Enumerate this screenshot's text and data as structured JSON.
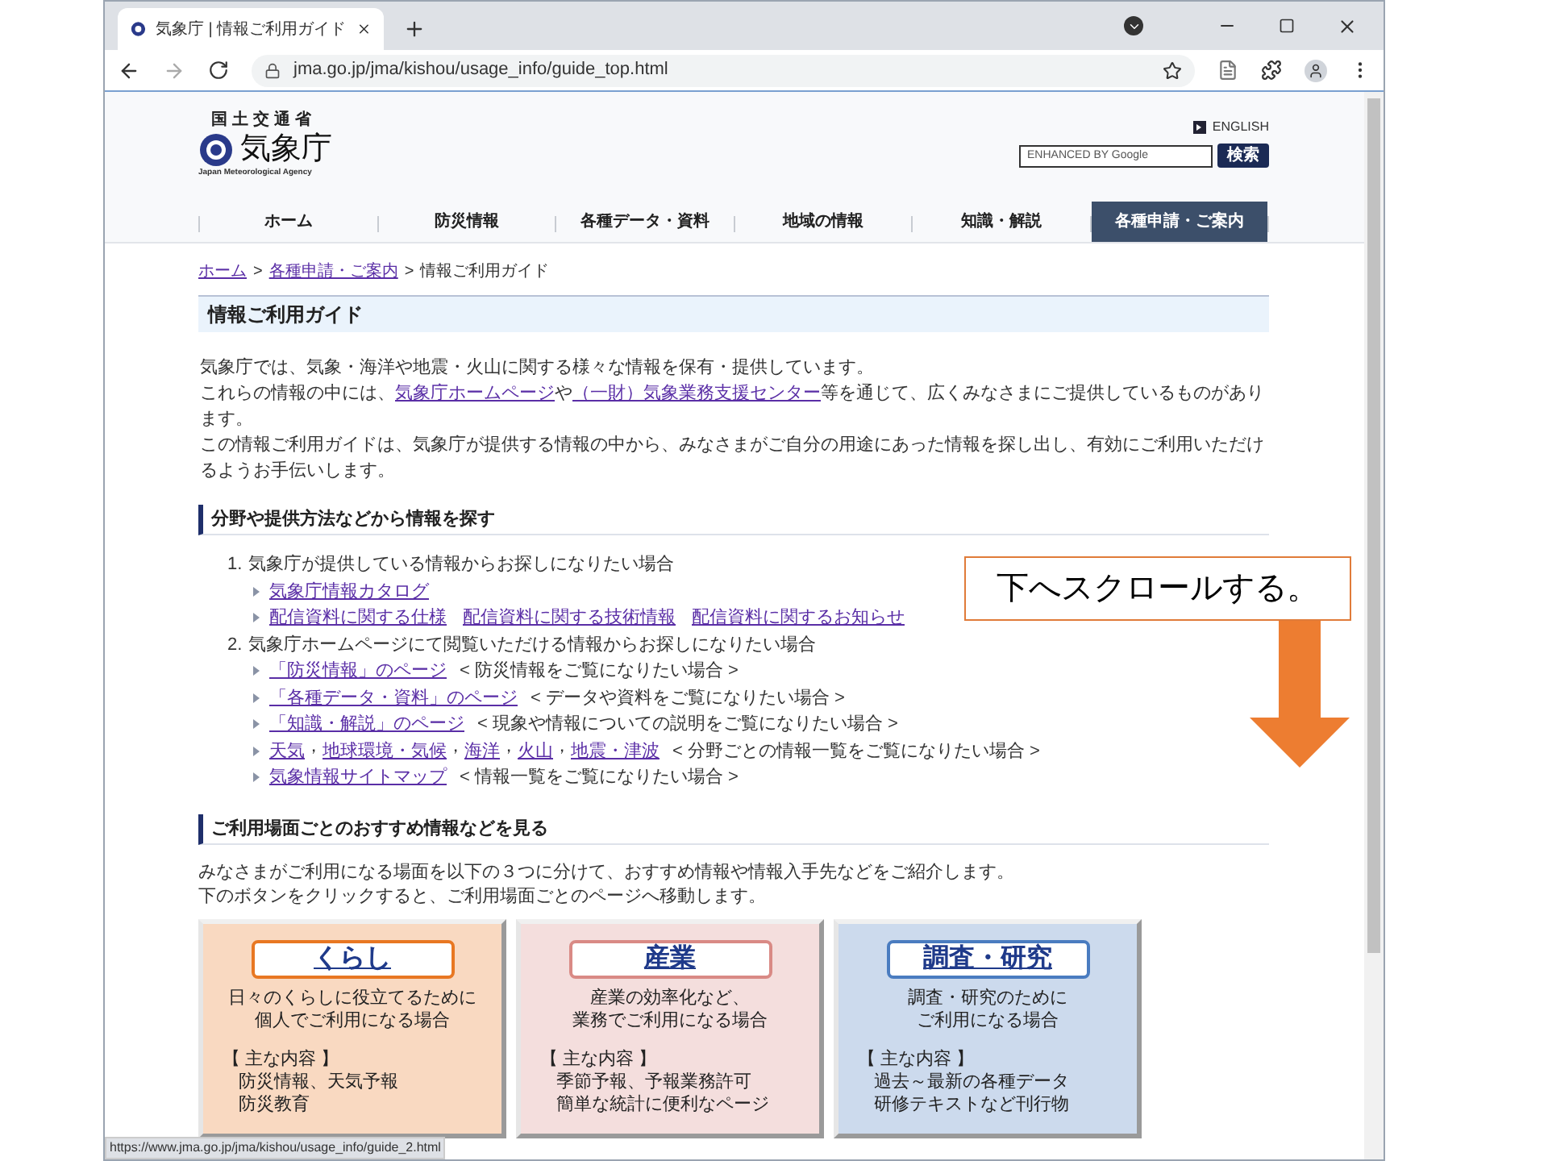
{
  "browser": {
    "tab_title": "気象庁 | 情報ご利用ガイド",
    "url": "jma.go.jp/jma/kishou/usage_info/guide_top.html",
    "status_url": "https://www.jma.go.jp/jma/kishou/usage_info/guide_2.html"
  },
  "header": {
    "ministry": "国土交通省",
    "logo_text": "気象庁",
    "logo_subtitle": "Japan Meteorological Agency",
    "english_link": "ENGLISH",
    "search_placeholder": "ENHANCED BY Google",
    "search_button": "検索"
  },
  "nav": [
    {
      "label": "ホーム",
      "selected": false
    },
    {
      "label": "防災情報",
      "selected": false
    },
    {
      "label": "各種データ・資料",
      "selected": false
    },
    {
      "label": "地域の情報",
      "selected": false
    },
    {
      "label": "知識・解説",
      "selected": false
    },
    {
      "label": "各種申請・ご案内",
      "selected": true
    }
  ],
  "breadcrumb": {
    "links": [
      "ホーム",
      "各種申請・ご案内"
    ],
    "separator": ">",
    "current": "情報ご利用ガイド"
  },
  "page_title": "情報ご利用ガイド",
  "intro": [
    [
      {
        "kind": "text",
        "text": "気象庁では、気象・海洋や地震・火山に関する様々な情報を保有・提供しています。"
      }
    ],
    [
      {
        "kind": "text",
        "text": "これらの情報の中には、"
      },
      {
        "kind": "link",
        "text": "気象庁ホームページ"
      },
      {
        "kind": "text",
        "text": "や"
      },
      {
        "kind": "link",
        "text": "（一財）気象業務支援センター"
      },
      {
        "kind": "text",
        "text": "等を通じて、広くみなさまにご提供しているものがあります。"
      }
    ],
    [
      {
        "kind": "text",
        "text": "この情報ご利用ガイドは、気象庁が提供する情報の中から、みなさまがご自分の用途にあった情報を探し出し、有効にご利用いただけるようお手伝いします。"
      }
    ]
  ],
  "section_search": {
    "heading": "分野や提供方法などから情報を探す",
    "items": [
      {
        "number": "1.",
        "text": "気象庁が提供している情報からお探しになりたい場合",
        "rows": [
          {
            "segments": [
              {
                "kind": "link",
                "text": "気象庁情報カタログ"
              }
            ]
          },
          {
            "segments": [
              {
                "kind": "link",
                "text": "配信資料に関する仕様"
              },
              {
                "kind": "link",
                "text": "配信資料に関する技術情報"
              },
              {
                "kind": "link",
                "text": "配信資料に関するお知らせ"
              }
            ]
          }
        ]
      },
      {
        "number": "2.",
        "text": "気象庁ホームページにて閲覧いただける情報からお探しになりたい場合",
        "rows": [
          {
            "segments": [
              {
                "kind": "link",
                "text": "「防災情報」のページ"
              },
              {
                "kind": "text",
                "text": "< 防災情報をご覧になりたい場合 >"
              }
            ]
          },
          {
            "segments": [
              {
                "kind": "link",
                "text": "「各種データ・資料」のページ"
              },
              {
                "kind": "text",
                "text": "< データや資料をご覧になりたい場合 >"
              }
            ]
          },
          {
            "segments": [
              {
                "kind": "link",
                "text": "「知識・解説」のページ"
              },
              {
                "kind": "text",
                "text": "< 現象や情報についての説明をご覧になりたい場合 >"
              }
            ]
          },
          {
            "segments": [
              {
                "kind": "link",
                "text": "天気"
              },
              {
                "kind": "comma",
                "text": "，"
              },
              {
                "kind": "link",
                "text": "地球環境・気候"
              },
              {
                "kind": "comma",
                "text": "，"
              },
              {
                "kind": "link",
                "text": "海洋"
              },
              {
                "kind": "comma",
                "text": "，"
              },
              {
                "kind": "link",
                "text": "火山"
              },
              {
                "kind": "comma",
                "text": "，"
              },
              {
                "kind": "link",
                "text": "地震・津波"
              },
              {
                "kind": "text",
                "text": "< 分野ごとの情報一覧をご覧になりたい場合 >"
              }
            ]
          },
          {
            "segments": [
              {
                "kind": "link",
                "text": "気象情報サイトマップ"
              },
              {
                "kind": "text",
                "text": "< 情報一覧をご覧になりたい場合 >"
              }
            ]
          }
        ]
      }
    ]
  },
  "section_scenes": {
    "heading": "ご利用場面ごとのおすすめ情報などを見る",
    "lines": [
      "みなさまがご利用になる場面を以下の３つに分けて、おすすめ情報や情報入手先などをご紹介します。",
      "下のボタンをクリックすると、ご利用場面ごとのページへ移動します。"
    ],
    "cards": [
      {
        "title": "くらし",
        "color": "#e87722",
        "description": [
          "日々のくらしに役立てるために",
          "個人でご利用になる場合"
        ],
        "contents_label": "【 主な内容 】",
        "contents": [
          "防災情報、天気予報",
          "防災教育"
        ]
      },
      {
        "title": "産業",
        "color": "#d98a85",
        "description": [
          "産業の効率化など、",
          "業務でご利用になる場合"
        ],
        "contents_label": "【 主な内容 】",
        "contents": [
          "季節予報、予報業務許可",
          "簡単な統計に便利なページ"
        ]
      },
      {
        "title": "調査・研究",
        "color": "#4a7cc0",
        "description": [
          "調査・研究のために",
          "ご利用になる場合"
        ],
        "contents_label": "【 主な内容 】",
        "contents": [
          "過去～最新の各種データ",
          "研修テキストなど刊行物"
        ]
      }
    ]
  },
  "annotation": {
    "text": "下へスクロールする。"
  }
}
